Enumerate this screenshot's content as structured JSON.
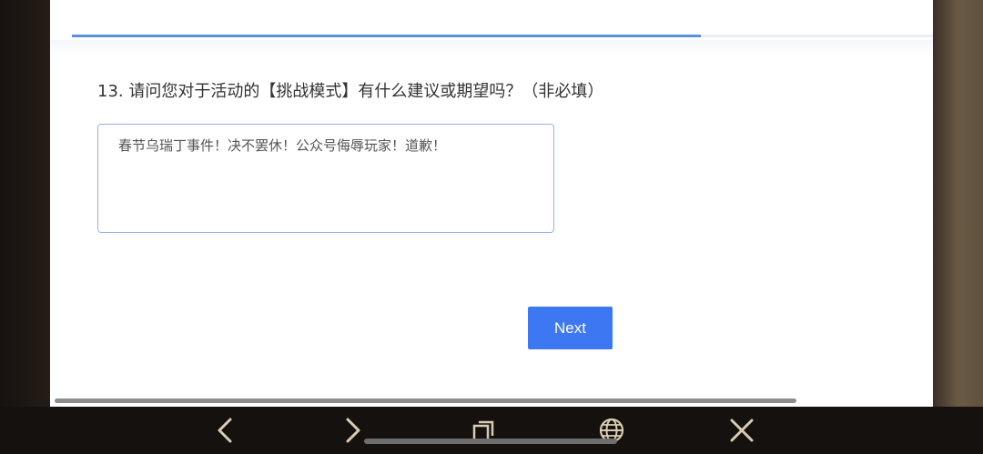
{
  "survey": {
    "progress_percent": 73,
    "question": {
      "title": "13. 请问您对于活动的【挑战模式】有什么建议或期望吗？（非必填）",
      "answer_value": "春节乌瑞丁事件！决不罢休！公众号侮辱玩家！道歉！"
    },
    "next_label": "Next"
  },
  "browser_toolbar": {
    "buttons": [
      {
        "name": "back",
        "icon": "chevron-left-icon"
      },
      {
        "name": "forward",
        "icon": "chevron-right-icon"
      },
      {
        "name": "tabs",
        "icon": "tabs-icon"
      },
      {
        "name": "globe",
        "icon": "globe-icon"
      },
      {
        "name": "close",
        "icon": "close-icon"
      }
    ]
  },
  "colors": {
    "accent": "#3d78f2",
    "progress": "#5b8fe3",
    "input_border": "#8fb3ee",
    "toolbar_icon": "#d9cdb4"
  }
}
